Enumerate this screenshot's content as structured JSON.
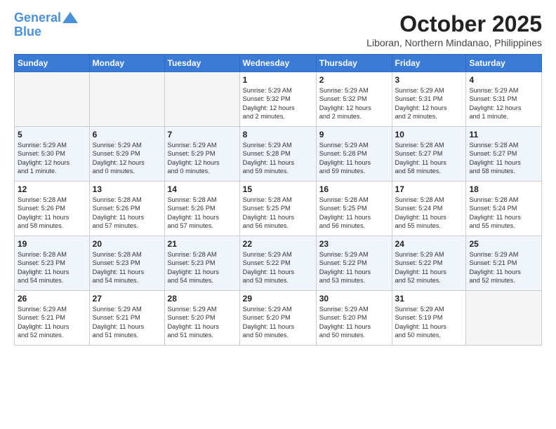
{
  "logo": {
    "line1": "General",
    "line2": "Blue"
  },
  "title": "October 2025",
  "location": "Liboran, Northern Mindanao, Philippines",
  "days_of_week": [
    "Sunday",
    "Monday",
    "Tuesday",
    "Wednesday",
    "Thursday",
    "Friday",
    "Saturday"
  ],
  "weeks": [
    [
      {
        "day": "",
        "info": ""
      },
      {
        "day": "",
        "info": ""
      },
      {
        "day": "",
        "info": ""
      },
      {
        "day": "1",
        "info": "Sunrise: 5:29 AM\nSunset: 5:32 PM\nDaylight: 12 hours\nand 2 minutes."
      },
      {
        "day": "2",
        "info": "Sunrise: 5:29 AM\nSunset: 5:32 PM\nDaylight: 12 hours\nand 2 minutes."
      },
      {
        "day": "3",
        "info": "Sunrise: 5:29 AM\nSunset: 5:31 PM\nDaylight: 12 hours\nand 2 minutes."
      },
      {
        "day": "4",
        "info": "Sunrise: 5:29 AM\nSunset: 5:31 PM\nDaylight: 12 hours\nand 1 minute."
      }
    ],
    [
      {
        "day": "5",
        "info": "Sunrise: 5:29 AM\nSunset: 5:30 PM\nDaylight: 12 hours\nand 1 minute."
      },
      {
        "day": "6",
        "info": "Sunrise: 5:29 AM\nSunset: 5:29 PM\nDaylight: 12 hours\nand 0 minutes."
      },
      {
        "day": "7",
        "info": "Sunrise: 5:29 AM\nSunset: 5:29 PM\nDaylight: 12 hours\nand 0 minutes."
      },
      {
        "day": "8",
        "info": "Sunrise: 5:29 AM\nSunset: 5:28 PM\nDaylight: 11 hours\nand 59 minutes."
      },
      {
        "day": "9",
        "info": "Sunrise: 5:29 AM\nSunset: 5:28 PM\nDaylight: 11 hours\nand 59 minutes."
      },
      {
        "day": "10",
        "info": "Sunrise: 5:28 AM\nSunset: 5:27 PM\nDaylight: 11 hours\nand 58 minutes."
      },
      {
        "day": "11",
        "info": "Sunrise: 5:28 AM\nSunset: 5:27 PM\nDaylight: 11 hours\nand 58 minutes."
      }
    ],
    [
      {
        "day": "12",
        "info": "Sunrise: 5:28 AM\nSunset: 5:26 PM\nDaylight: 11 hours\nand 58 minutes."
      },
      {
        "day": "13",
        "info": "Sunrise: 5:28 AM\nSunset: 5:26 PM\nDaylight: 11 hours\nand 57 minutes."
      },
      {
        "day": "14",
        "info": "Sunrise: 5:28 AM\nSunset: 5:26 PM\nDaylight: 11 hours\nand 57 minutes."
      },
      {
        "day": "15",
        "info": "Sunrise: 5:28 AM\nSunset: 5:25 PM\nDaylight: 11 hours\nand 56 minutes."
      },
      {
        "day": "16",
        "info": "Sunrise: 5:28 AM\nSunset: 5:25 PM\nDaylight: 11 hours\nand 56 minutes."
      },
      {
        "day": "17",
        "info": "Sunrise: 5:28 AM\nSunset: 5:24 PM\nDaylight: 11 hours\nand 55 minutes."
      },
      {
        "day": "18",
        "info": "Sunrise: 5:28 AM\nSunset: 5:24 PM\nDaylight: 11 hours\nand 55 minutes."
      }
    ],
    [
      {
        "day": "19",
        "info": "Sunrise: 5:28 AM\nSunset: 5:23 PM\nDaylight: 11 hours\nand 54 minutes."
      },
      {
        "day": "20",
        "info": "Sunrise: 5:28 AM\nSunset: 5:23 PM\nDaylight: 11 hours\nand 54 minutes."
      },
      {
        "day": "21",
        "info": "Sunrise: 5:28 AM\nSunset: 5:23 PM\nDaylight: 11 hours\nand 54 minutes."
      },
      {
        "day": "22",
        "info": "Sunrise: 5:29 AM\nSunset: 5:22 PM\nDaylight: 11 hours\nand 53 minutes."
      },
      {
        "day": "23",
        "info": "Sunrise: 5:29 AM\nSunset: 5:22 PM\nDaylight: 11 hours\nand 53 minutes."
      },
      {
        "day": "24",
        "info": "Sunrise: 5:29 AM\nSunset: 5:22 PM\nDaylight: 11 hours\nand 52 minutes."
      },
      {
        "day": "25",
        "info": "Sunrise: 5:29 AM\nSunset: 5:21 PM\nDaylight: 11 hours\nand 52 minutes."
      }
    ],
    [
      {
        "day": "26",
        "info": "Sunrise: 5:29 AM\nSunset: 5:21 PM\nDaylight: 11 hours\nand 52 minutes."
      },
      {
        "day": "27",
        "info": "Sunrise: 5:29 AM\nSunset: 5:21 PM\nDaylight: 11 hours\nand 51 minutes."
      },
      {
        "day": "28",
        "info": "Sunrise: 5:29 AM\nSunset: 5:20 PM\nDaylight: 11 hours\nand 51 minutes."
      },
      {
        "day": "29",
        "info": "Sunrise: 5:29 AM\nSunset: 5:20 PM\nDaylight: 11 hours\nand 50 minutes."
      },
      {
        "day": "30",
        "info": "Sunrise: 5:29 AM\nSunset: 5:20 PM\nDaylight: 11 hours\nand 50 minutes."
      },
      {
        "day": "31",
        "info": "Sunrise: 5:29 AM\nSunset: 5:19 PM\nDaylight: 11 hours\nand 50 minutes."
      },
      {
        "day": "",
        "info": ""
      }
    ]
  ]
}
